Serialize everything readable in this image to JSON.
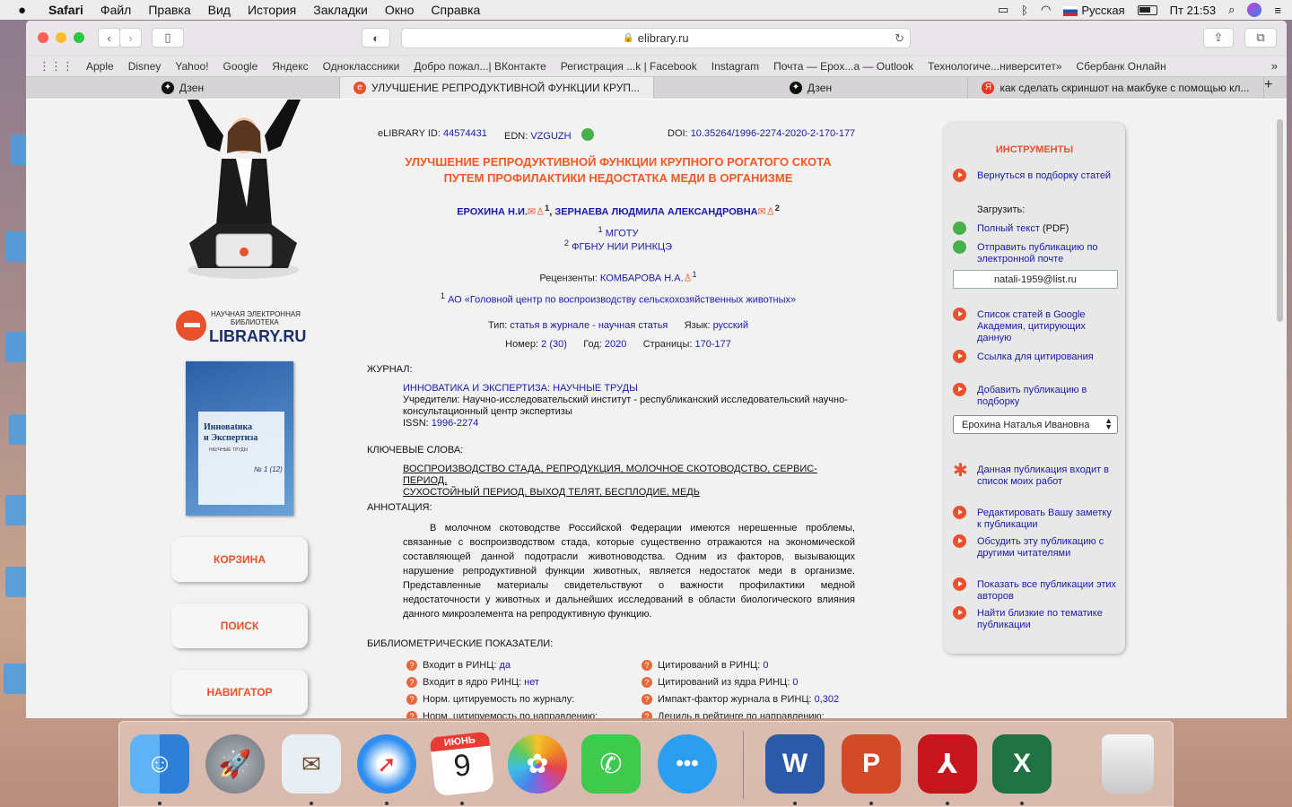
{
  "menubar": {
    "app": "Safari",
    "items": [
      "Файл",
      "Правка",
      "Вид",
      "История",
      "Закладки",
      "Окно",
      "Справка"
    ],
    "input_source": "Русская",
    "clock": "Пт 21:53"
  },
  "browser": {
    "address": "elibrary.ru",
    "bookmarks": [
      "Apple",
      "Disney",
      "Yahoo!",
      "Google",
      "Яндекс",
      "Одноклассники",
      "Добро пожал...| ВКонтакте",
      "Регистрация ...k | Facebook",
      "Instagram",
      "Почта — Epox...a — Outlook",
      "Технологиче...ниверситет»",
      "Сбербанк Онлайн"
    ],
    "tabs": [
      {
        "label": "Дзен",
        "icon": "zen-icon",
        "active": false
      },
      {
        "label": "УЛУЧШЕНИЕ РЕПРОДУКТИВНОЙ ФУНКЦИИ КРУП...",
        "icon": "elibrary-icon",
        "active": true
      },
      {
        "label": "Дзен",
        "icon": "zen-icon",
        "active": false
      },
      {
        "label": "как сделать скриншот на макбуке с помощью кл...",
        "icon": "yandex-icon",
        "active": false
      }
    ]
  },
  "sidebar": {
    "logo_line1": "НАУЧНАЯ ЭЛЕКТРОННАЯ",
    "logo_line2": "БИБЛИОТЕКА",
    "logo_name": "LIBRARY.RU",
    "cover_title_1": "Инновatика",
    "cover_title_2": "и Экспертиза",
    "cover_sub": "НАУЧНЫЕ ТРУДЫ",
    "cover_issue": "№ 1 (12)",
    "buttons": [
      "КОРЗИНА",
      "ПОИСК",
      "НАВИГАТОР"
    ]
  },
  "article": {
    "elibrary_id_label": "eLIBRARY ID:",
    "elibrary_id": "44574431",
    "edn_label": "EDN:",
    "edn": "VZGUZH",
    "doi_label": "DOI:",
    "doi": "10.35264/1996-2274-2020-2-170-177",
    "title_1": "УЛУЧШЕНИЕ РЕПРОДУКТИВНОЙ ФУНКЦИИ КРУПНОГО РОГАТОГО СКОТА",
    "title_2": "ПУТЕМ ПРОФИЛАКТИКИ НЕДОСТАТКА МЕДИ В ОРГАНИЗМЕ",
    "author_1": "ЕРОХИНА Н.И.",
    "author_1_sup": "1",
    "author_2": "ЗЕРНАЕВА ЛЮДМИЛА АЛЕКСАНДРОВНА",
    "author_2_sup": "2",
    "affil_1_num": "1",
    "affil_1": "МГОТУ",
    "affil_2_num": "2",
    "affil_2": "ФГБНУ НИИ РИНКЦЭ",
    "reviewers_label": "Рецензенты:",
    "reviewer": "КОМБАРОВА Н.А.",
    "reviewer_sup": "1",
    "review_org_num": "1",
    "review_org": "АО «Головной центр по воспроизводству сельскохозяйственных животных»",
    "type_label": "Тип:",
    "type": "статья в журнале - научная статья",
    "lang_label": "Язык:",
    "lang": "русский",
    "number_label": "Номер:",
    "number": "2 (30)",
    "year_label": "Год:",
    "year": "2020",
    "pages_label": "Страницы:",
    "pages": "170-177",
    "journal_heading": "ЖУРНАЛ:",
    "journal_name": "ИННОВАТИКА И ЭКСПЕРТИЗА: НАУЧНЫЕ ТРУДЫ",
    "founders_1": "Учредители: Научно-исследовательский институт - республиканский исследовательский научно-",
    "founders_2": "консультационный центр экспертизы",
    "issn_label": "ISSN:",
    "issn": "1996-2274",
    "keywords_heading": "КЛЮЧЕВЫЕ СЛОВА:",
    "keywords_1": "ВОСПРОИЗВОДСТВО СТАДА, РЕПРОДУКЦИЯ, МОЛОЧНОЕ СКОТОВОДСТВО, СЕРВИС-ПЕРИОД,",
    "keywords_2": "СУХОСТОЙНЫЙ ПЕРИОД, ВЫХОД ТЕЛЯТ, БЕСПЛОДИЕ, МЕДЬ",
    "abstract_heading": "АННОТАЦИЯ:",
    "abstract": "В молочном скотоводстве Российской Федерации имеются нерешенные проблемы, связанные с воспроизводством стада, которые существенно отражаются на экономической составляющей данной подотрасли животноводства. Одним из факторов, вызывающих нарушение репродуктивной функции животных, является недостаток меди в организме. Представленные материалы свидетельствуют о важности профилактики медной недостаточности у животных и дальнейших исследований в области биологического влияния данного микроэлемента на репродуктивную функцию.",
    "biblio_heading": "БИБЛИОМЕТРИЧЕСКИЕ ПОКАЗАТЕЛИ:",
    "metrics_left": [
      {
        "label": "Входит в РИНЦ:",
        "value": "да"
      },
      {
        "label": "Входит в ядро РИНЦ:",
        "value": "нет"
      },
      {
        "label": "Норм. цитируемость по журналу:",
        "value": ""
      },
      {
        "label": "Норм. цитируемость по направлению:",
        "value": ""
      }
    ],
    "metrics_right": [
      {
        "label": "Цитирований в РИНЦ:",
        "value": "0"
      },
      {
        "label": "Цитирований из ядра РИНЦ:",
        "value": "0"
      },
      {
        "label": "Импакт-фактор журнала в РИНЦ:",
        "value": "0,302"
      },
      {
        "label": "Дециль в рейтинге по направлению:",
        "value": ""
      }
    ]
  },
  "tools": {
    "heading": "ИНСТРУМЕНТЫ",
    "back": "Вернуться в подборку статей",
    "download_label": "Загрузить:",
    "full_text": "Полный текст",
    "full_text_suffix": "(PDF)",
    "email_1": "Отправить публикацию по",
    "email_2": "электронной почте",
    "email_value": "natali-1959@list.ru",
    "scholar_1": "Список статей в Google",
    "scholar_2": "Академия, цитирующих",
    "scholar_3": "данную",
    "cite": "Ссылка для цитирования",
    "add_1": "Добавить публикацию в",
    "add_2": "подборку",
    "select_value": "Ерохина Наталья Ивановна",
    "mine_1": "Данная публикация входит в",
    "mine_2": "список моих работ",
    "note_1": "Редактировать Вашу заметку",
    "note_2": "к публикации",
    "discuss_1": "Обсудить эту публикацию с",
    "discuss_2": "другими читателями",
    "all_1": "Показать все публикации этих",
    "all_2": "авторов",
    "similar_1": "Найти близкие по тематике",
    "similar_2": "публикации"
  },
  "dock": {
    "calendar_month": "ИЮНЬ",
    "calendar_day": "9"
  }
}
